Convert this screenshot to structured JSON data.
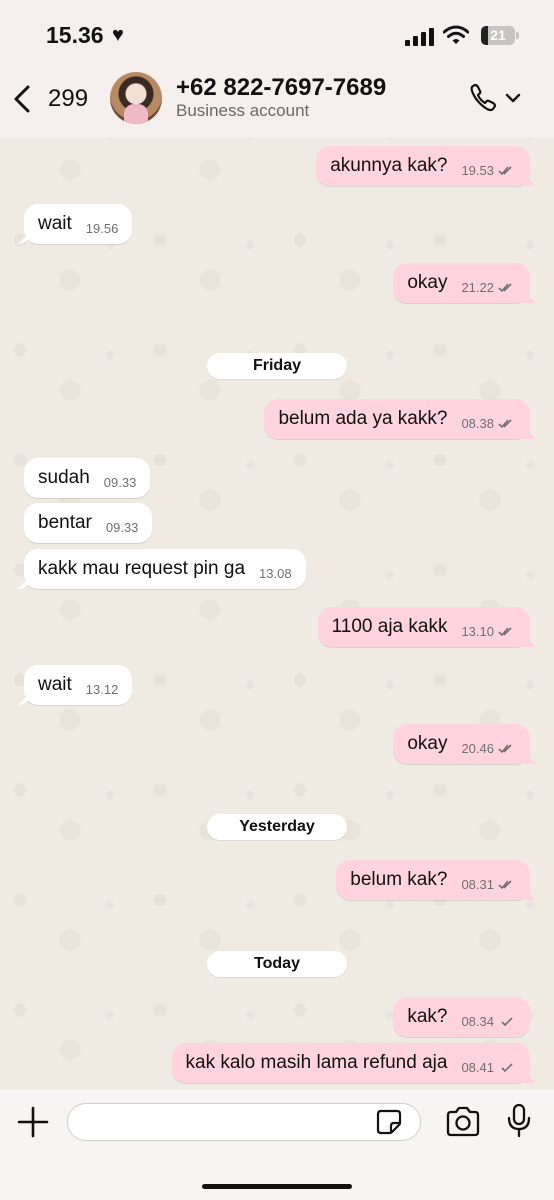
{
  "status_bar": {
    "time": "15.36",
    "battery": "21",
    "battery_level": 0.21
  },
  "header": {
    "back_count": "299",
    "contact_name": "+62 822-7697-7689",
    "subtitle": "Business account"
  },
  "messages": [
    {
      "dir": "out",
      "text": "akunnya kak?",
      "time": "19.53",
      "ticks": "read"
    },
    {
      "dir": "in",
      "text": "wait",
      "time": "19.56"
    },
    {
      "dir": "out",
      "text": "okay",
      "time": "21.22",
      "ticks": "read"
    },
    {
      "dir": "out",
      "text": "belum ada ya kakk?",
      "time": "08.38",
      "ticks": "read"
    },
    {
      "dir": "in",
      "text": "sudah",
      "time": "09.33"
    },
    {
      "dir": "in",
      "text": "bentar",
      "time": "09.33"
    },
    {
      "dir": "in",
      "text": "kakk mau request pin ga",
      "time": "13.08"
    },
    {
      "dir": "out",
      "text": "1100 aja kakk",
      "time": "13.10",
      "ticks": "read"
    },
    {
      "dir": "in",
      "text": "wait",
      "time": "13.12"
    },
    {
      "dir": "out",
      "text": "okay",
      "time": "20.46",
      "ticks": "read"
    },
    {
      "dir": "out",
      "text": "belum kak?",
      "time": "08.31",
      "ticks": "read"
    },
    {
      "dir": "out",
      "text": "kak?",
      "time": "08.34",
      "ticks": "sent"
    },
    {
      "dir": "out",
      "text": "kak kalo masih lama refund aja",
      "time": "08.41",
      "ticks": "sent"
    }
  ],
  "date_chips": [
    "Friday",
    "Yesterday",
    "Today"
  ],
  "input": {
    "value": "",
    "placeholder": ""
  },
  "icons": {
    "back": "chevron-left-icon",
    "call": "phone-icon",
    "plus": "plus-icon",
    "sticker": "sticker-icon",
    "camera": "camera-icon",
    "mic": "microphone-icon"
  },
  "colors": {
    "outgoing_bubble": "#ffd4df",
    "incoming_bubble": "#ffffff",
    "chat_background": "#efeae2"
  }
}
